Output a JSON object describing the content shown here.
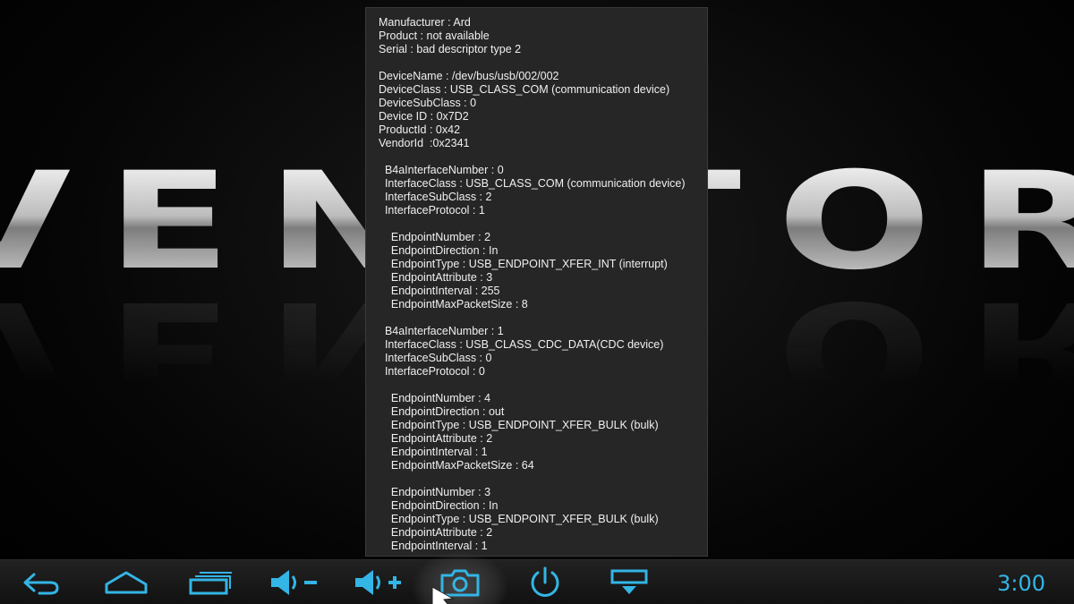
{
  "wallpaper": {
    "logo_text": "VENATOR"
  },
  "dialog": {
    "lines": [
      "Manufacturer : Ard",
      "Product : not available",
      "Serial : bad descriptor type 2",
      "",
      "DeviceName : /dev/bus/usb/002/002",
      "DeviceClass : USB_CLASS_COM (communication device)",
      "DeviceSubClass : 0",
      "Device ID : 0x7D2",
      "ProductId : 0x42",
      "VendorId  :0x2341",
      "",
      "  B4aInterfaceNumber : 0",
      "  InterfaceClass : USB_CLASS_COM (communication device)",
      "  InterfaceSubClass : 2",
      "  InterfaceProtocol : 1",
      "",
      "    EndpointNumber : 2",
      "    EndpointDirection : In",
      "    EndpointType : USB_ENDPOINT_XFER_INT (interrupt)",
      "    EndpointAttribute : 3",
      "    EndpointInterval : 255",
      "    EndpointMaxPacketSize : 8",
      "",
      "  B4aInterfaceNumber : 1",
      "  InterfaceClass : USB_CLASS_CDC_DATA(CDC device)",
      "  InterfaceSubClass : 0",
      "  InterfaceProtocol : 0",
      "",
      "    EndpointNumber : 4",
      "    EndpointDirection : out",
      "    EndpointType : USB_ENDPOINT_XFER_BULK (bulk)",
      "    EndpointAttribute : 2",
      "    EndpointInterval : 1",
      "    EndpointMaxPacketSize : 64",
      "",
      "    EndpointNumber : 3",
      "    EndpointDirection : In",
      "    EndpointType : USB_ENDPOINT_XFER_BULK (bulk)",
      "    EndpointAttribute : 2",
      "    EndpointInterval : 1"
    ]
  },
  "navbar": {
    "icon_color": "#33b5e5",
    "buttons": [
      {
        "name": "back",
        "icon": "back-arrow-icon"
      },
      {
        "name": "home",
        "icon": "home-icon"
      },
      {
        "name": "recent-apps",
        "icon": "recent-apps-icon"
      },
      {
        "name": "volume-down",
        "icon": "volume-down-icon"
      },
      {
        "name": "volume-up",
        "icon": "volume-up-icon"
      },
      {
        "name": "screenshot",
        "icon": "camera-icon",
        "pressed": true
      },
      {
        "name": "power",
        "icon": "power-icon"
      },
      {
        "name": "hide-bar",
        "icon": "hide-bar-icon"
      }
    ],
    "clock": "3:00"
  }
}
